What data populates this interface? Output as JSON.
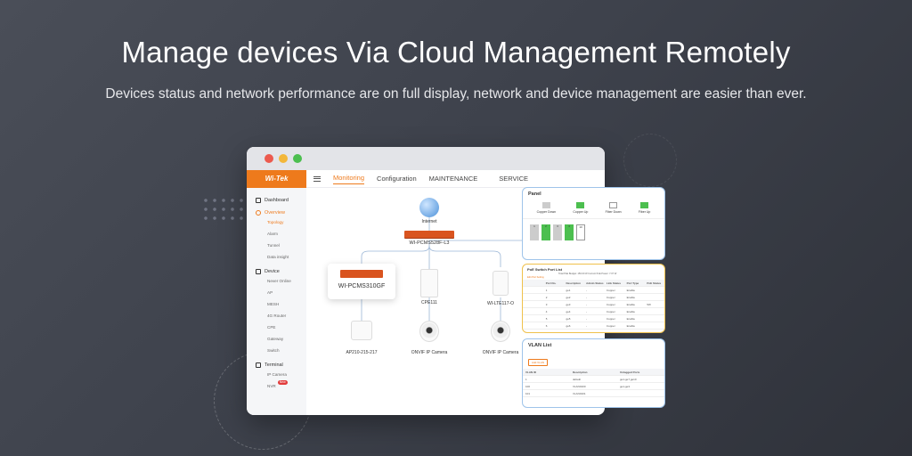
{
  "headline": "Manage devices Via Cloud Management Remotely",
  "subline": "Devices status and network performance are on full display, network and device management are easier than ever.",
  "colors": {
    "accent": "#ee7a1c",
    "red_light": "#ec5a4e",
    "yellow_light": "#f3b73a",
    "green_light": "#4cbf4f",
    "panel_border": "#9fc4ea"
  },
  "window": {
    "logo": "Wi-Tek",
    "nav": {
      "monitoring": "Monitoring",
      "configuration": "Configuration",
      "maintenance": "MAINTENANCE",
      "service": "SERVICE"
    },
    "sidebar": {
      "dashboard": "Dashboard",
      "overview": "Overview",
      "overview_items": [
        "Topology",
        "Alarm",
        "Tunnel",
        "Data insight"
      ],
      "device": "Device",
      "device_items": [
        "Never Online",
        "AP",
        "MESH",
        "4G Router",
        "CPE",
        "Gateway",
        "Switch"
      ],
      "terminal": "Terminal",
      "terminal_items": [
        "IP Camera",
        "NVR"
      ],
      "nvr_badge": "New"
    },
    "topology": {
      "internet": "Internet",
      "core_switch": "WI-PCMS528F-L3",
      "poe_switch": "WI-PCMS310GF",
      "cpe": "CPE111",
      "lte": "WI-LTE117-O",
      "ap": "AP210-215-217",
      "camera1": "ONVIF IP Camera",
      "camera2": "ONVIF IP Camera"
    }
  },
  "panels": {
    "panel": {
      "title": "Panel",
      "legend": [
        "Copper Down",
        "Copper Up",
        "Fiber Down",
        "Fiber Up"
      ],
      "port_nums": [
        "1",
        "2",
        "3",
        "4",
        "10"
      ]
    },
    "poe": {
      "title": "PoE Switch Port List",
      "info": "Total PoE Budget: 150.00 W  Current PoE Power: 7.07 W",
      "action": "Edit Port Setting",
      "columns": [
        "",
        "Port No.",
        "Description",
        "Admin Status",
        "Link Status",
        "Port Type",
        "PoE Status"
      ],
      "rows": [
        [
          "",
          "1",
          "ge1",
          "-",
          "Copper",
          "Enable",
          ""
        ],
        [
          "",
          "2",
          "ge2",
          "-",
          "Copper",
          "Enable",
          ""
        ],
        [
          "",
          "3",
          "ge3",
          "-",
          "Copper",
          "Enable",
          "5W"
        ],
        [
          "",
          "4",
          "ge4",
          "-",
          "Copper",
          "Enable",
          ""
        ],
        [
          "",
          "5",
          "ge5",
          "-",
          "Copper",
          "Enable",
          ""
        ],
        [
          "",
          "6",
          "ge6",
          "-",
          "Copper",
          "Enable",
          ""
        ],
        [
          "",
          "7",
          "ge7",
          "-",
          "Copper",
          "Enable",
          ""
        ]
      ]
    },
    "vlan": {
      "title": "VLAN List",
      "add": "Add VLAN",
      "columns": [
        "VLAN ID",
        "Description",
        "Untagged Ports"
      ],
      "rows": [
        [
          "1",
          "default",
          "ge1-ge7,ge10"
        ],
        [
          "100",
          "VLAN0100",
          "ge1-ge3"
        ],
        [
          "101",
          "VLAN0101",
          ""
        ]
      ]
    }
  }
}
